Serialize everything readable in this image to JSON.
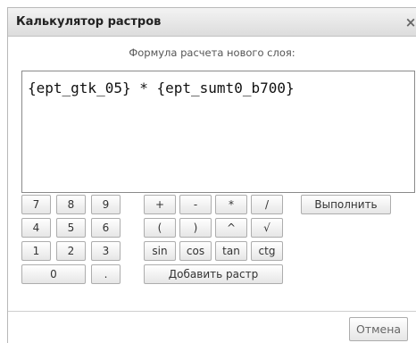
{
  "dialog": {
    "title": "Калькулятор растров",
    "close_glyph": "×",
    "formula_label": "Формула расчета нового слоя:",
    "formula_value": "{ept_gtk_05} * {ept_sumt0_b700}"
  },
  "keypad": {
    "digits": [
      "7",
      "8",
      "9",
      "4",
      "5",
      "6",
      "1",
      "2",
      "3",
      "0",
      "."
    ],
    "operators": [
      "+",
      "-",
      "*",
      "/",
      "(",
      ")",
      "^",
      "√",
      "sin",
      "cos",
      "tan",
      "ctg"
    ],
    "add_raster": "Добавить растр",
    "execute": "Выполнить"
  },
  "footer": {
    "cancel": "Отмена"
  }
}
